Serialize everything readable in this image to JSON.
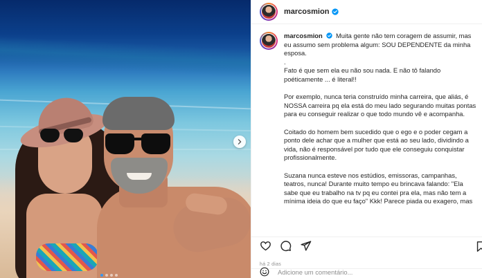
{
  "post": {
    "username": "marcosmion",
    "verified": true,
    "caption": {
      "first": "Muita gente não tem coragem de assumir, mas eu assumo sem problema algum: SOU DEPENDENTE da minha esposa.",
      "dot": ".",
      "p2": "Fato é que sem ela eu não sou nada. E não tô falando poéticamente ... é literal!!",
      "p3": "Por exemplo, nunca teria construído minha carreira, que aliás, é NOSSA carreira pq ela está do meu lado segurando muitas pontas para eu conseguir realizar o que todo mundo vê e acompanha.",
      "p4": "Coitado do homem bem sucedido que o ego e o poder cegam a ponto dele achar que a mulher que está ao seu lado, dividindo a vida, não é responsável por tudo que ele conseguiu conquistar profissionalmente.",
      "p5": "Suzana nunca esteve nos estúdios, emissoras, campanhas, teatros, nunca! Durante muito tempo eu brincava falando: \"Ela sabe que eu trabalho na tv pq eu contei pra ela, mas não tem a mínima ideia do que eu faço\" Kkk! Parece piada ou exagero, mas"
    },
    "time_ago": "há 2 dias",
    "comment_placeholder": "Adicione um comentário..."
  },
  "media": {
    "carousel_dots": 4,
    "active_dot": 1
  },
  "colors": {
    "verified": "#0095f6",
    "text": "#262626",
    "muted": "#8e8e8e",
    "divider": "#efefef"
  },
  "icons": {
    "header_verified": "verified-badge-icon",
    "next": "chevron-right-icon",
    "like": "heart-icon",
    "comment": "comment-icon",
    "share": "paper-plane-icon",
    "save": "bookmark-icon",
    "emoji": "smiley-icon"
  }
}
